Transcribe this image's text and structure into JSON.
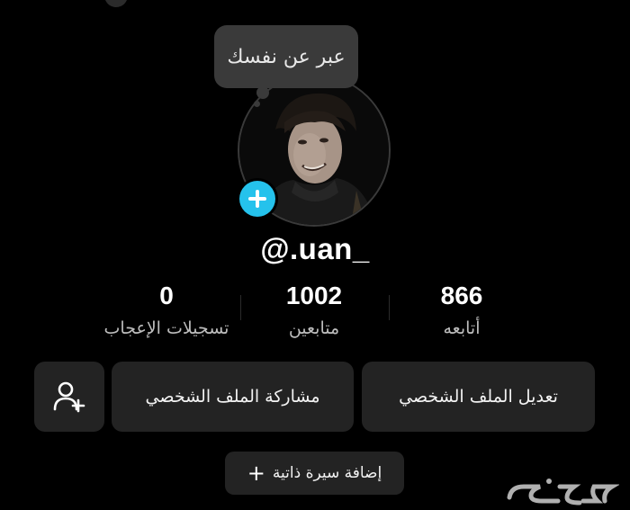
{
  "profile": {
    "bio_prompt": "عبر عن نفسك",
    "username": "@.uan_"
  },
  "stats": {
    "following": {
      "value": "866",
      "label": "أتابعه"
    },
    "followers": {
      "value": "1002",
      "label": "متابعين"
    },
    "likes": {
      "value": "0",
      "label": "تسجيلات الإعجاب"
    }
  },
  "actions": {
    "edit_profile": "تعديل الملف الشخصي",
    "share_profile": "مشاركة الملف الشخصي",
    "add_bio": "إضافة سيرة ذاتية"
  },
  "icons": {
    "add_avatar": "plus-icon",
    "add_friend": "add-user-icon",
    "add_bio": "plus-icon"
  },
  "colors": {
    "background": "#000000",
    "accent": "#25c2ec",
    "button": "#232323"
  }
}
